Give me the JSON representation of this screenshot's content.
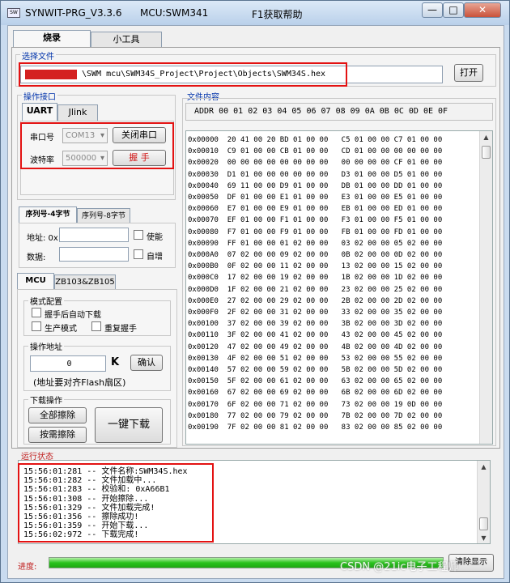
{
  "window": {
    "title": "SYNWIT-PRG_V3.3.6",
    "mcu": "MCU:SWM341",
    "help": "F1获取帮助",
    "minimize": "—",
    "maximize": "□",
    "close": "✕"
  },
  "main_tabs": [
    "烧录",
    "小工具"
  ],
  "file_select": {
    "label": "选择文件",
    "path": "\\SWM  mcu\\SWM34S_Project\\Project\\Objects\\SWM34S.hex",
    "open_button": "打开"
  },
  "port": {
    "label": "操作接口",
    "tabs": [
      "UART",
      "Jlink"
    ],
    "serial_label": "串口号",
    "serial_value": "COM13",
    "close_port_button": "关闭串口",
    "baud_label": "波特率",
    "baud_value": "500000",
    "handshake_button": "握  手"
  },
  "serial_number": {
    "tabs": [
      "序列号-4字节",
      "序列号-8字节"
    ],
    "address_label": "地址: 0x",
    "enable_label": "使能",
    "data_label": "数据:",
    "auto_inc_label": "自增"
  },
  "mcu_panel": {
    "tabs": [
      "MCU",
      "ZB103&ZB105"
    ],
    "mode_label": "模式配置",
    "auto_download_label": "握手后自动下载",
    "production_mode_label": "生产模式",
    "rehandshake_label": "重复握手",
    "address_label": "操作地址",
    "address_value": "0",
    "address_unit": "K",
    "confirm_button": "确认",
    "address_note": "(地址要对齐Flash扇区)",
    "download_label": "下载操作",
    "erase_all_button": "全部擦除",
    "erase_needed_button": "按需擦除",
    "one_click_download_button": "一键下载"
  },
  "file_content": {
    "label": "文件内容",
    "header": "ADDR   00 01 02 03 04 05 06 07   08 09 0A 0B 0C 0D 0E 0F",
    "rows": [
      "0x00000  20 41 00 20 BD 01 00 00   C5 01 00 00 C7 01 00 00",
      "0x00010  C9 01 00 00 CB 01 00 00   CD 01 00 00 00 00 00 00",
      "0x00020  00 00 00 00 00 00 00 00   00 00 00 00 CF 01 00 00",
      "0x00030  D1 01 00 00 00 00 00 00   D3 01 00 00 D5 01 00 00",
      "0x00040  69 11 00 00 D9 01 00 00   DB 01 00 00 DD 01 00 00",
      "0x00050  DF 01 00 00 E1 01 00 00   E3 01 00 00 E5 01 00 00",
      "0x00060  E7 01 00 00 E9 01 00 00   EB 01 00 00 ED 01 00 00",
      "0x00070  EF 01 00 00 F1 01 00 00   F3 01 00 00 F5 01 00 00",
      "0x00080  F7 01 00 00 F9 01 00 00   FB 01 00 00 FD 01 00 00",
      "0x00090  FF 01 00 00 01 02 00 00   03 02 00 00 05 02 00 00",
      "0x000A0  07 02 00 00 09 02 00 00   0B 02 00 00 0D 02 00 00",
      "0x000B0  0F 02 00 00 11 02 00 00   13 02 00 00 15 02 00 00",
      "0x000C0  17 02 00 00 19 02 00 00   1B 02 00 00 1D 02 00 00",
      "0x000D0  1F 02 00 00 21 02 00 00   23 02 00 00 25 02 00 00",
      "0x000E0  27 02 00 00 29 02 00 00   2B 02 00 00 2D 02 00 00",
      "0x000F0  2F 02 00 00 31 02 00 00   33 02 00 00 35 02 00 00",
      "0x00100  37 02 00 00 39 02 00 00   3B 02 00 00 3D 02 00 00",
      "0x00110  3F 02 00 00 41 02 00 00   43 02 00 00 45 02 00 00",
      "0x00120  47 02 00 00 49 02 00 00   4B 02 00 00 4D 02 00 00",
      "0x00130  4F 02 00 00 51 02 00 00   53 02 00 00 55 02 00 00",
      "0x00140  57 02 00 00 59 02 00 00   5B 02 00 00 5D 02 00 00",
      "0x00150  5F 02 00 00 61 02 00 00   63 02 00 00 65 02 00 00",
      "0x00160  67 02 00 00 69 02 00 00   6B 02 00 00 6D 02 00 00",
      "0x00170  6F 02 00 00 71 02 00 00   73 02 00 00 19 0D 00 00",
      "0x00180  77 02 00 00 79 02 00 00   7B 02 00 00 7D 02 00 00",
      "0x00190  7F 02 00 00 81 02 00 00   83 02 00 00 85 02 00 00"
    ]
  },
  "status": {
    "label": "运行状态",
    "lines": [
      "15:56:01:281 -- 文件名称:SWM34S.hex",
      "15:56:01:282 -- 文件加载中...",
      "15:56:01:283 -- 校验和: 0xA66B1",
      "15:56:01:308 -- 开始擦除...",
      "15:56:01:329 -- 文件加载完成!",
      "15:56:01:356 -- 擦除成功!",
      "15:56:01:359 -- 开始下载...",
      "15:56:02:972 -- 下载完成!"
    ]
  },
  "progress": {
    "label": "进度:",
    "percent": 100,
    "clear_button": "清除显示"
  },
  "watermark": "CSDN @21ic电子工程师",
  "colors": {
    "highlight": "#e31212",
    "progress": "#29c31c",
    "group_label": "#0033aa"
  }
}
